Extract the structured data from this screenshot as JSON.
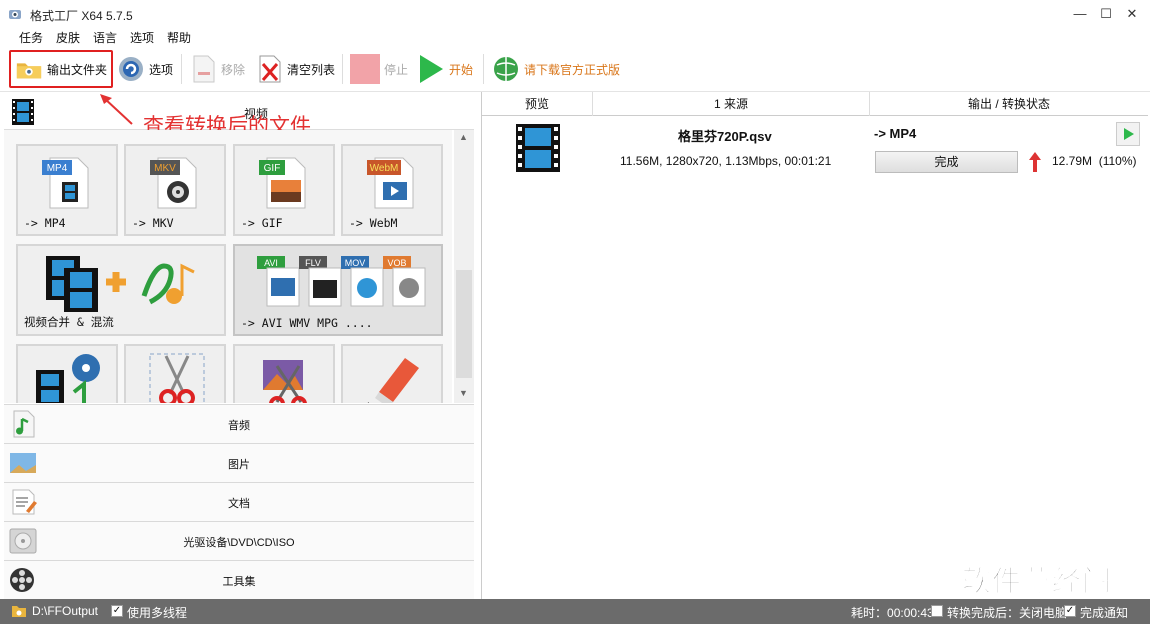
{
  "window": {
    "title": "格式工厂 X64 5.7.5",
    "minimize_icon": "minimize-icon",
    "maximize_icon": "maximize-icon",
    "close_icon": "close-icon"
  },
  "menu": [
    "任务",
    "皮肤",
    "语言",
    "选项",
    "帮助"
  ],
  "toolbar": {
    "output_folder": "输出文件夹",
    "options": "选项",
    "remove": "移除",
    "clear_list": "清空列表",
    "stop": "停止",
    "start": "开始",
    "download_official": "请下载官方正式版"
  },
  "annotation": "查看转换后的文件",
  "left": {
    "video_header": "视频",
    "tiles": [
      {
        "label": "-> MP4",
        "badge": "MP4",
        "badge_color": "#3a7fd0"
      },
      {
        "label": "-> MKV",
        "badge": "MKV",
        "badge_color": "#555555"
      },
      {
        "label": "-> GIF",
        "badge": "GIF",
        "badge_color": "#2e9e3e"
      },
      {
        "label": "-> WebM",
        "badge": "WebM",
        "badge_color": "#c8562a"
      },
      {
        "label": "视频合并 & 混流"
      },
      {
        "label": "-> AVI WMV MPG ....",
        "badges": [
          "AVI",
          "FLV",
          "MOV",
          "VOB"
        ]
      }
    ],
    "categories": [
      "音频",
      "图片",
      "文档",
      "光驱设备\\DVD\\CD\\ISO",
      "工具集"
    ]
  },
  "table": {
    "col_preview": "预览",
    "col_source": "1 来源",
    "col_output": "输出 / 转换状态",
    "row": {
      "file_name": "格里芬720P.qsv",
      "file_info": "11.56M, 1280x720, 1.13Mbps, 00:01:21",
      "target": "-> MP4",
      "status": "完成",
      "output_size": "12.79M",
      "ratio": "(110%)"
    }
  },
  "watermark": "软件藏经阁",
  "statusbar": {
    "output_path": "D:\\FFOutput",
    "multithread": "使用多线程",
    "elapsed_label": "耗时：",
    "elapsed_value": "00:00:43",
    "after_done": "转换完成后：关闭电脑",
    "notify": "完成通知"
  },
  "colors": {
    "accent_red": "#e02020",
    "start_green": "#2db84b",
    "download_orange": "#d9761a",
    "status_bar": "#6b6b6b"
  }
}
